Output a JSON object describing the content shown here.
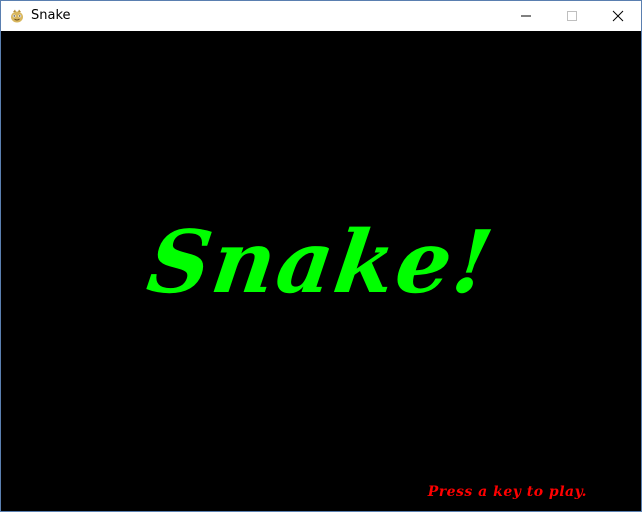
{
  "window": {
    "title": "Snake",
    "controls": {
      "minimize": "minimize",
      "maximize": "maximize",
      "close": "close"
    }
  },
  "game": {
    "title": "Snake!",
    "prompt": "Press a key to play.",
    "colors": {
      "background": "#000000",
      "title": "#00ff00",
      "prompt": "#ff0000"
    }
  },
  "icons": {
    "app": "pygame-snake-icon",
    "minimize": "minimize-icon",
    "maximize": "maximize-icon",
    "close": "close-icon"
  }
}
